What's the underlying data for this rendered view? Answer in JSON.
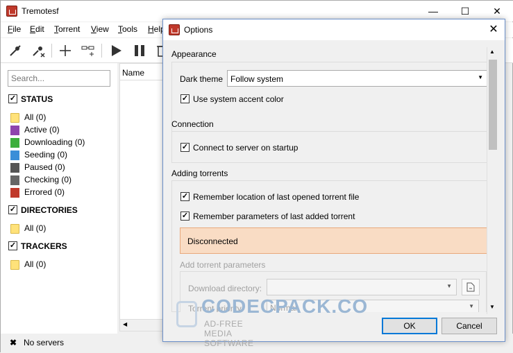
{
  "main_window": {
    "title": "Tremotesf",
    "controls": {
      "minimize": "—",
      "maximize": "☐",
      "close": "✕"
    }
  },
  "menubar": {
    "items": [
      {
        "first": "F",
        "rest": "ile"
      },
      {
        "first": "E",
        "rest": "dit"
      },
      {
        "first": "T",
        "rest": "orrent"
      },
      {
        "first": "V",
        "rest": "iew"
      },
      {
        "first": "T",
        "rest": "ools"
      },
      {
        "first": "H",
        "rest": "elp"
      }
    ]
  },
  "toolbar": {
    "icons": [
      "connect-icon",
      "disconnect-icon",
      "add-icon",
      "add-link-icon",
      "start-icon",
      "pause-icon",
      "remove-icon"
    ]
  },
  "sidebar": {
    "search_placeholder": "Search...",
    "status_header": "STATUS",
    "status_items": [
      {
        "label": "All (0)",
        "icon": "folder-icon",
        "color": "#ffe27a"
      },
      {
        "label": "Active (0)",
        "icon": "active-icon",
        "color": "#8e44ad"
      },
      {
        "label": "Downloading (0)",
        "icon": "download-icon",
        "color": "#3cae3c"
      },
      {
        "label": "Seeding (0)",
        "icon": "seed-icon",
        "color": "#3a8ed8"
      },
      {
        "label": "Paused (0)",
        "icon": "pause-icon",
        "color": "#555555"
      },
      {
        "label": "Checking (0)",
        "icon": "checking-icon",
        "color": "#666666"
      },
      {
        "label": "Errored (0)",
        "icon": "error-icon",
        "color": "#c0392b"
      }
    ],
    "directories_header": "DIRECTORIES",
    "directories_items": [
      {
        "label": "All (0)"
      }
    ],
    "trackers_header": "TRACKERS",
    "trackers_items": [
      {
        "label": "All (0)"
      }
    ]
  },
  "torrent_list": {
    "column_name": "Name"
  },
  "statusbar": {
    "text": "No servers"
  },
  "dialog": {
    "title": "Options",
    "close": "✕",
    "appearance_label": "Appearance",
    "dark_theme_label": "Dark theme",
    "dark_theme_value": "Follow system",
    "accent_label": "Use system accent color",
    "connection_label": "Connection",
    "connect_startup_label": "Connect to server on startup",
    "adding_label": "Adding torrents",
    "remember_location_label": "Remember location of last opened torrent file",
    "remember_params_label": "Remember parameters of last added torrent",
    "disconnected_text": "Disconnected",
    "add_params_label": "Add torrent parameters",
    "download_dir_label": "Download directory:",
    "priority_label": "Torrent priority:",
    "priority_value": "Normal",
    "ok_label": "OK",
    "cancel_label": "Cancel"
  },
  "watermark": {
    "title": "CODECPACK.CO",
    "subtitle": "AD-FREE MEDIA SOFTWARE"
  }
}
